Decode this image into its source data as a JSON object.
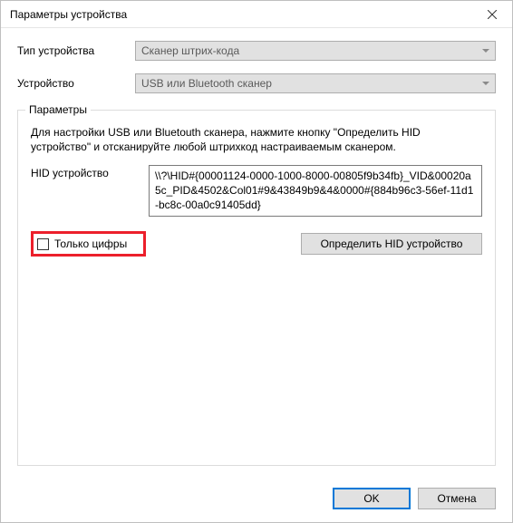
{
  "window": {
    "title": "Параметры устройства"
  },
  "form": {
    "type_label": "Тип устройства",
    "type_value": "Сканер штрих-кода",
    "device_label": "Устройство",
    "device_value": "USB или Bluetooth сканер"
  },
  "group": {
    "title": "Параметры",
    "instructions": "Для настройки USB или Bluetouth сканера, нажмите кнопку \"Определить HID устройство\" и отсканируйте любой штрихкод настраиваемым сканером.",
    "hid_label": "HID устройство",
    "hid_value": "\\\\?\\HID#{00001124-0000-1000-8000-00805f9b34fb}_VID&00020a5c_PID&4502&Col01#9&43849b9&4&0000#{884b96c3-56ef-11d1-bc8c-00a0c91405dd}",
    "digits_only_label": "Только цифры",
    "digits_only_checked": false,
    "detect_button": "Определить HID устройство"
  },
  "footer": {
    "ok": "OK",
    "cancel": "Отмена"
  }
}
